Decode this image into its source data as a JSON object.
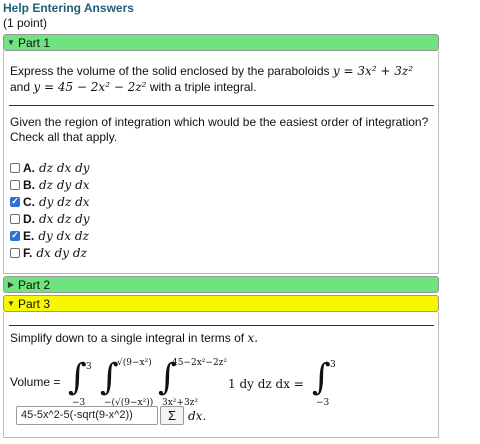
{
  "help_link": "Help Entering Answers",
  "points": "(1 point)",
  "parts": {
    "part1": {
      "label": "Part 1",
      "expanded": true,
      "color": "#6ee37f"
    },
    "part2": {
      "label": "Part 2",
      "expanded": false,
      "color": "#6ee37f"
    },
    "part3": {
      "label": "Part 3",
      "expanded": true,
      "color": "#f7f700"
    }
  },
  "problem": {
    "intro": "Express the volume of the solid enclosed by the paraboloids",
    "eq1": "y = 3x² + 3z²",
    "conj": "and",
    "eq2": "y = 45 − 2x² − 2z²",
    "tail": "with a triple integral."
  },
  "question": {
    "line1": "Given the region of integration which would be the easiest order of integration?",
    "line2": "Check all that apply."
  },
  "options": [
    {
      "letter": "A.",
      "expr": "dz dx dy",
      "checked": false
    },
    {
      "letter": "B.",
      "expr": "dz dy dx",
      "checked": false
    },
    {
      "letter": "C.",
      "expr": "dy dz dx",
      "checked": true
    },
    {
      "letter": "D.",
      "expr": "dx dz dy",
      "checked": false
    },
    {
      "letter": "E.",
      "expr": "dy dx dz",
      "checked": true
    },
    {
      "letter": "F.",
      "expr": "dx dy dz",
      "checked": false
    }
  ],
  "part3": {
    "instruction": "Simplify down to a single integral in terms of",
    "var": "x.",
    "volume_label": "Volume =",
    "outer_upper": "3",
    "outer_lower": "−3",
    "mid_upper": "√(9−x²)",
    "mid_lower": "−(√(9−x²))",
    "inner_upper": "45−2x²−2z²",
    "inner_lower": "3x²+3z²",
    "integrand": "1 dy dz dx =",
    "rhs_upper": "3",
    "rhs_lower": "−3",
    "answer_value": "45-5x^2-5(-sqrt(9-x^2))",
    "sigma": "Σ",
    "dx": "dx."
  }
}
